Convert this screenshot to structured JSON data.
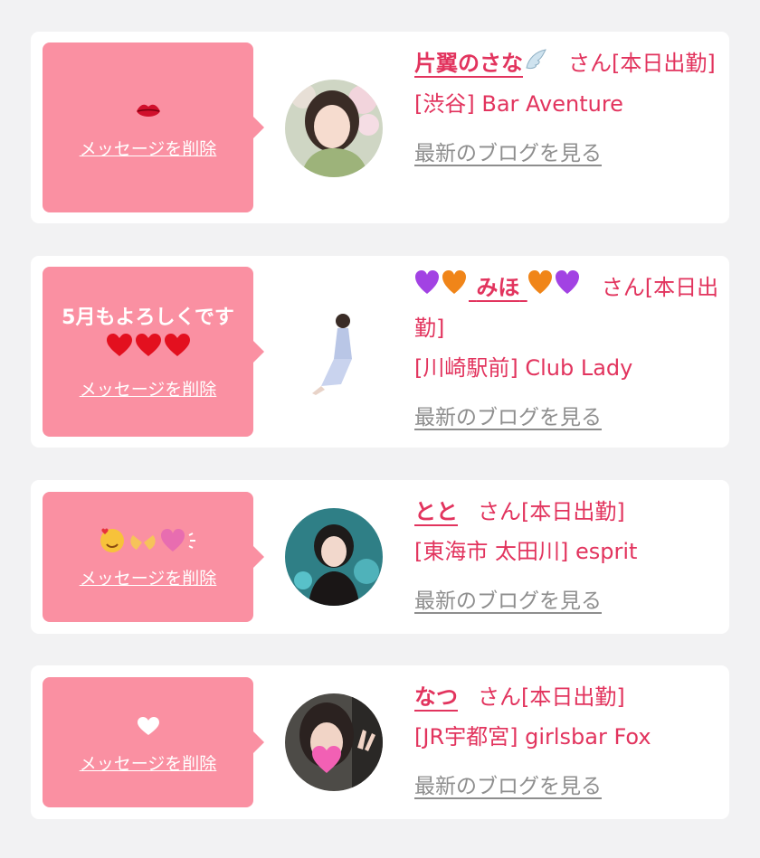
{
  "cards": [
    {
      "message": "",
      "message_emoji": "lips-icon",
      "delete_label": "メッセージを削除",
      "name": "片翼のさな",
      "name_emoji": "wing-icon",
      "honorific": "さん[本日出勤]",
      "location": "[渋谷] Bar Aventure",
      "blog_label": "最新のブログを見る"
    },
    {
      "message": "5月もよろしくです",
      "message_emoji": "red-heart-icon",
      "delete_label": "メッセージを削除",
      "name": "みほ",
      "name_emoji": "purple-orange-hearts-icon",
      "honorific": "さん[本日出勤]",
      "location": "[川崎駅前] Club Lady",
      "blog_label": "最新のブログを見る"
    },
    {
      "message": "",
      "message_emoji": "smiling-face-hearts-hands-icon",
      "delete_label": "メッセージを削除",
      "name": "とと",
      "honorific": "さん[本日出勤]",
      "location": "[東海市 太田川] esprit",
      "blog_label": "最新のブログを見る"
    },
    {
      "message": "",
      "message_emoji": "white-heart-icon",
      "delete_label": "メッセージを削除",
      "name": "なつ",
      "honorific": "さん[本日出勤]",
      "location": "[JR宇都宮] girlsbar Fox",
      "blog_label": "最新のブログを見る"
    }
  ],
  "colors": {
    "accent": "#e2345e",
    "bubble": "#fa90a2",
    "link_gray": "#8e8e8e",
    "background": "#f2f2f3"
  }
}
